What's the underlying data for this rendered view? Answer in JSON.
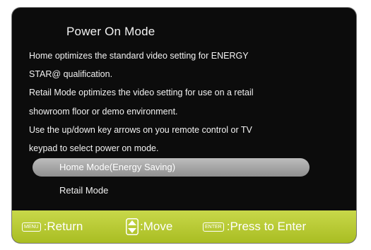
{
  "dialog": {
    "title": "Power On Mode",
    "description_lines": [
      "Home optimizes the standard video setting for ENERGY",
      "STAR@ qualification.",
      "Retail Mode optimizes the video setting for use on a retail",
      "showroom floor or demo environment.",
      "Use the up/down key arrows on you remote control or TV",
      "keypad to select power on mode."
    ],
    "options": [
      {
        "label": "Home Mode(Energy  Saving)",
        "selected": true
      },
      {
        "label": "Retail Mode",
        "selected": false
      }
    ]
  },
  "footer": {
    "menu_key": "MENU",
    "return_label": ":Return",
    "move_label": ":Move",
    "enter_key": "ENTER",
    "enter_label": ":Press to Enter"
  },
  "colors": {
    "background": "#0c0c0c",
    "footer": "#b3c42c",
    "selected_option": "#a8a8a8",
    "text": "#f2f2f2"
  },
  "icons": [
    "up-down-arrows-icon"
  ]
}
